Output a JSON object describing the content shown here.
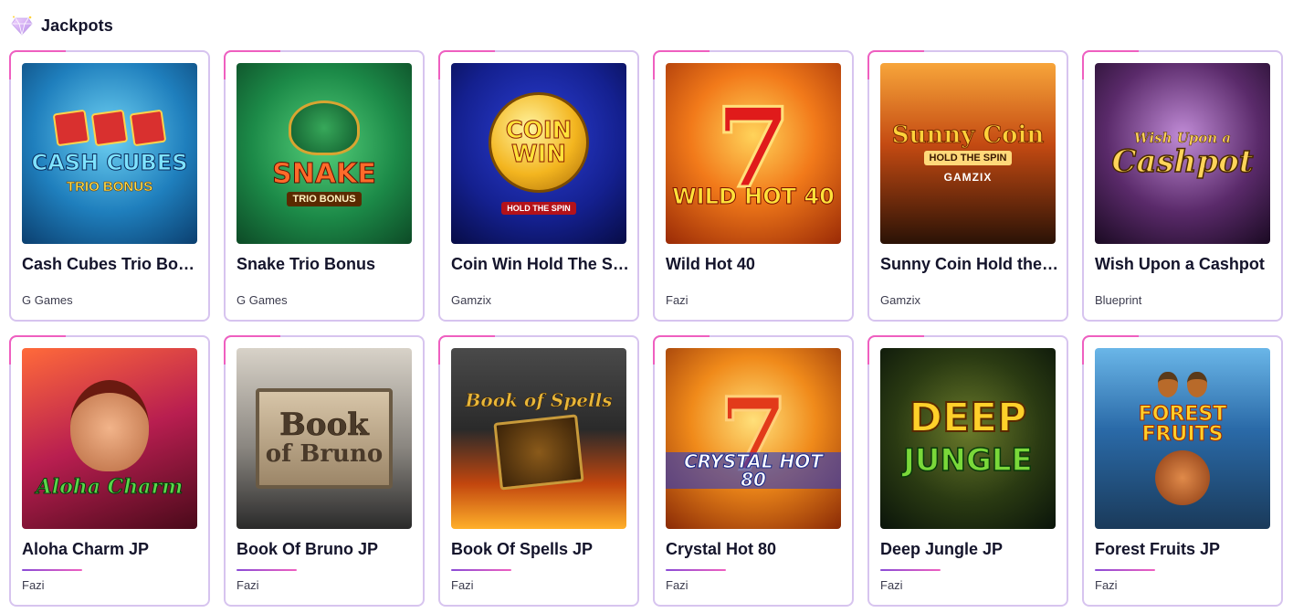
{
  "section": {
    "title": "Jackpots",
    "icon": "diamond-icon"
  },
  "games": [
    {
      "name": "Cash Cubes Trio Bonus",
      "provider": "G Games",
      "art_title": "CASH CUBES",
      "art_sub": "TRIO BONUS"
    },
    {
      "name": "Snake Trio Bonus",
      "provider": "G Games",
      "art_title": "SNAKE",
      "art_sub": "TRIO BONUS"
    },
    {
      "name": "Coin Win Hold The Spin",
      "provider": "Gamzix",
      "art_title": "COIN WIN",
      "art_sub": "HOLD THE SPIN"
    },
    {
      "name": "Wild Hot 40",
      "provider": "Fazi",
      "art_title": "WILD HOT 40",
      "art_sub": "7"
    },
    {
      "name": "Sunny Coin Hold the Spin",
      "provider": "Gamzix",
      "art_title": "Sunny Coin",
      "art_sub": "HOLD THE SPIN",
      "art_brand": "GAMZIX"
    },
    {
      "name": "Wish Upon a Cashpot",
      "provider": "Blueprint",
      "art_title": "Cashpot",
      "art_sub": "Wish Upon a"
    },
    {
      "name": "Aloha Charm JP",
      "provider": "Fazi",
      "art_title": "Aloha Charm"
    },
    {
      "name": "Book Of Bruno JP",
      "provider": "Fazi",
      "art_title": "Book",
      "art_sub": "of Bruno"
    },
    {
      "name": "Book Of Spells JP",
      "provider": "Fazi",
      "art_title": "Book of Spells"
    },
    {
      "name": "Crystal Hot 80",
      "provider": "Fazi",
      "art_title": "CRYSTAL HOT 80",
      "art_sub": "7"
    },
    {
      "name": "Deep Jungle JP",
      "provider": "Fazi",
      "art_title": "DEEP",
      "art_sub": "JUNGLE"
    },
    {
      "name": "Forest Fruits JP",
      "provider": "Fazi",
      "art_title": "FOREST FRUITS"
    }
  ]
}
